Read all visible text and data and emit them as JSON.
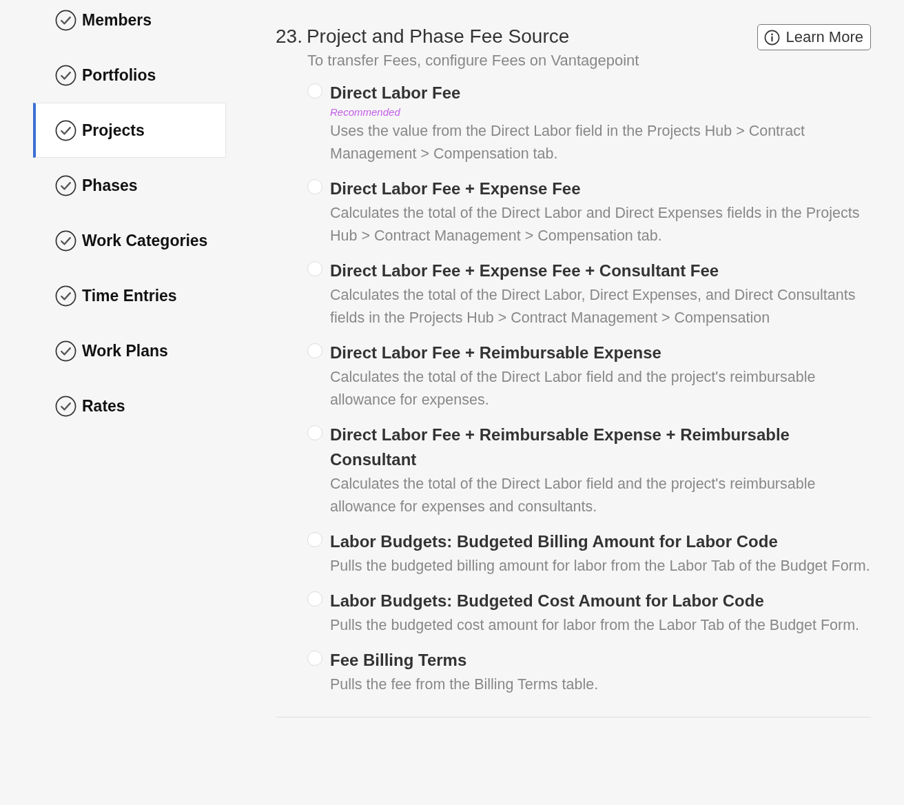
{
  "sidebar": {
    "items": [
      {
        "label": "Members",
        "completed": true,
        "selected": false
      },
      {
        "label": "Portfolios",
        "completed": true,
        "selected": false
      },
      {
        "label": "Projects",
        "completed": true,
        "selected": true
      },
      {
        "label": "Phases",
        "completed": true,
        "selected": false
      },
      {
        "label": "Work Categories",
        "completed": true,
        "selected": false
      },
      {
        "label": "Time Entries",
        "completed": true,
        "selected": false
      },
      {
        "label": "Work Plans",
        "completed": true,
        "selected": false
      },
      {
        "label": "Rates",
        "completed": true,
        "selected": false
      }
    ]
  },
  "section": {
    "number": "23.",
    "title": "Project and Phase Fee Source",
    "subtitle": "To transfer Fees, configure Fees on Vantagepoint",
    "learn_more": "Learn More",
    "options": [
      {
        "title": "Direct Labor Fee",
        "badge": "Recommended",
        "description": "Uses the value from the Direct Labor field in the Projects Hub > Contract Management > Compensation tab.",
        "selected": false
      },
      {
        "title": "Direct Labor Fee + Expense Fee",
        "description": "Calculates the total of the Direct Labor and Direct Expenses fields in the Projects Hub > Contract Management > Compensation tab.",
        "selected": false
      },
      {
        "title": "Direct Labor Fee + Expense Fee + Consultant Fee",
        "description": "Calculates the total of the Direct Labor, Direct Expenses, and Direct Consultants fields in the Projects Hub > Contract Management > Compensation",
        "selected": false
      },
      {
        "title": "Direct Labor Fee + Reimbursable Expense",
        "description": "Calculates the total of the Direct Labor field and the project's reimbursable allowance for expenses.",
        "selected": false
      },
      {
        "title": "Direct Labor Fee + Reimbursable Expense + Reimbursable Consultant",
        "description": "Calculates the total of the Direct Labor field and the project's reimbursable allowance for expenses and consultants.",
        "selected": false
      },
      {
        "title": "Labor Budgets: Budgeted Billing Amount for Labor Code",
        "description": "Pulls the budgeted billing amount for labor from the Labor Tab of the Budget Form.",
        "selected": false
      },
      {
        "title": "Labor Budgets: Budgeted Cost Amount for Labor Code",
        "description": "Pulls the budgeted cost amount for labor from the Labor Tab of the Budget Form.",
        "selected": false
      },
      {
        "title": "Fee Billing Terms",
        "description": "Pulls the fee from the Billing Terms table.",
        "selected": false
      }
    ]
  }
}
